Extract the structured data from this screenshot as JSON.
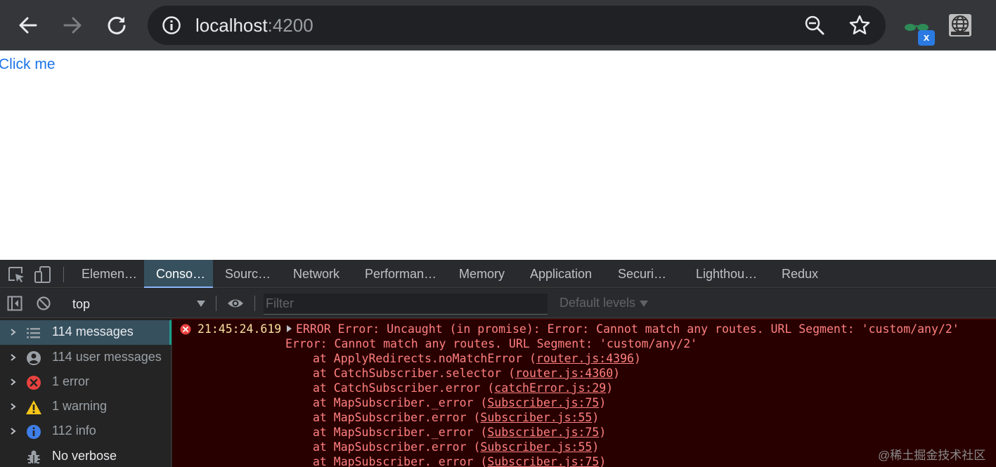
{
  "browser": {
    "url_host": "localhost",
    "url_port": ":4200",
    "ext_badge": "x"
  },
  "page": {
    "link_text": "Click me"
  },
  "devtools": {
    "tabs": [
      "Elemen…",
      "Conso…",
      "Sourc…",
      "Network",
      "Performan…",
      "Memory",
      "Application",
      "Securi…",
      "Lighthou…",
      "Redux"
    ],
    "context": "top",
    "filter_placeholder": "Filter",
    "levels_label": "Default levels",
    "sidebar": [
      {
        "label": "114 messages",
        "icon": "list-icon"
      },
      {
        "label": "114 user messages",
        "icon": "user-icon"
      },
      {
        "label": "1 error",
        "icon": "error-icon"
      },
      {
        "label": "1 warning",
        "icon": "warning-icon"
      },
      {
        "label": "112 info",
        "icon": "info-icon"
      },
      {
        "label": "No verbose",
        "icon": "verbose-icon"
      }
    ],
    "console": {
      "timestamp": "21:45:24.619",
      "message": "ERROR Error: Uncaught (in promise): Error: Cannot match any routes. URL Segment: 'custom/any/2'",
      "detail": "Error: Cannot match any routes. URL Segment: 'custom/any/2'",
      "stack": [
        {
          "prefix": "at ApplyRedirects.noMatchError (",
          "file": "router.js:4396",
          "suffix": ")"
        },
        {
          "prefix": "at CatchSubscriber.selector (",
          "file": "router.js:4360",
          "suffix": ")"
        },
        {
          "prefix": "at CatchSubscriber.error (",
          "file": "catchError.js:29",
          "suffix": ")"
        },
        {
          "prefix": "at MapSubscriber._error (",
          "file": "Subscriber.js:75",
          "suffix": ")"
        },
        {
          "prefix": "at MapSubscriber.error (",
          "file": "Subscriber.js:55",
          "suffix": ")"
        },
        {
          "prefix": "at MapSubscriber._error (",
          "file": "Subscriber.js:75",
          "suffix": ")"
        },
        {
          "prefix": "at MapSubscriber.error (",
          "file": "Subscriber.js:55",
          "suffix": ")"
        },
        {
          "prefix": "at MapSubscriber._error (",
          "file": "Subscriber.js:75",
          "suffix": ")"
        }
      ]
    }
  },
  "watermark": "@稀土掘金技术社区",
  "colors": {
    "toolbar_bg": "#35363a",
    "omnibox_bg": "#202124",
    "link_blue": "#1a73e8",
    "error_bg": "#290000",
    "error_text": "#ff8080",
    "timestamp": "#f9e1a0",
    "active_tab_bg": "#36505e",
    "selected_accent": "#1e9c8b"
  }
}
